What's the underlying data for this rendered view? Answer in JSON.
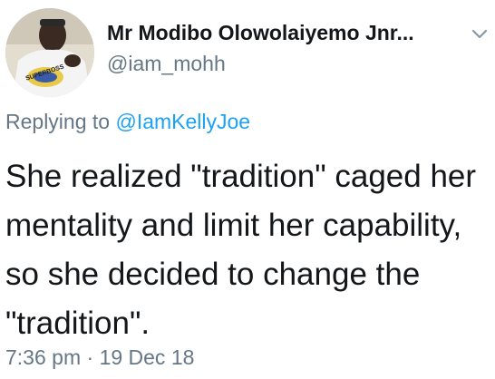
{
  "tweet": {
    "author": {
      "display_name": "Mr Modibo Olowolaiyemo Jnr...",
      "handle": "@iam_mohh",
      "avatar_shirt_text": "SUPERBOSS"
    },
    "reply": {
      "prefix": "Replying to",
      "mention": "@IamKellyJoe"
    },
    "text": "She realized \"tradition\" caged her mentality and limit her capability, so she decided to change the \"tradition\".",
    "time": "7:36 pm",
    "separator": "·",
    "date": "19 Dec 18"
  },
  "icons": {
    "menu": "chevron-down-icon"
  },
  "colors": {
    "text": "#14171a",
    "secondary": "#657786",
    "link": "#1da1f2"
  }
}
